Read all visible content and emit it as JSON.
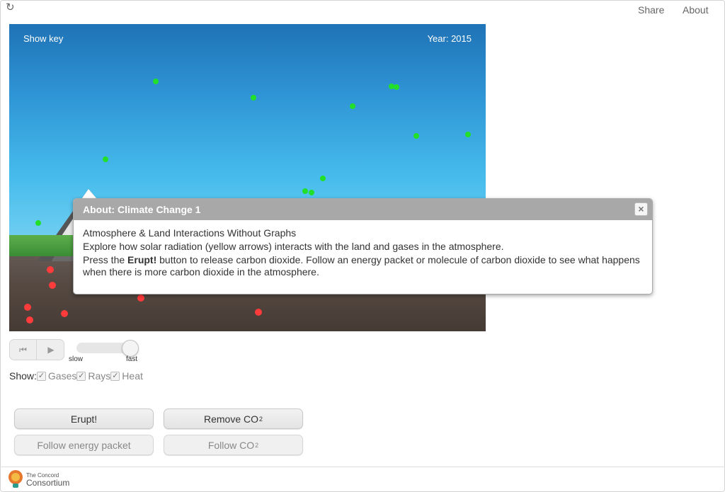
{
  "toolbar": {
    "reload_icon": "reload-icon",
    "share": "Share",
    "about": "About"
  },
  "sim": {
    "show_key": "Show key",
    "year": "Year: 2015",
    "colors": {
      "gas": "#22e02a",
      "heat": "#ff3b3b"
    }
  },
  "controls": {
    "reset_icon": "skip-back-icon",
    "play_icon": "play-icon",
    "slow": "slow",
    "fast": "fast",
    "speed_level": 0.95,
    "show_label": "Show:",
    "show_options": [
      {
        "label": "Gases",
        "checked": true
      },
      {
        "label": "Rays",
        "checked": true
      },
      {
        "label": "Heat",
        "checked": true
      }
    ]
  },
  "buttons": {
    "erupt": "Erupt!",
    "remove_co2": "Remove CO",
    "remove_co2_sub": "2",
    "follow_energy": "Follow energy packet",
    "follow_co2": "Follow CO",
    "follow_co2_sub": "2"
  },
  "footer": {
    "logo_line1": "The Concord",
    "logo_line2": "Consortium"
  },
  "dialog": {
    "title": "About: Climate Change 1",
    "close": "×",
    "line1": "Atmosphere & Land Interactions Without Graphs",
    "line2": "Explore how solar radiation (yellow arrows) interacts with the land and gases in the atmosphere.",
    "line3_pre": "Press the ",
    "line3_bold": "Erupt!",
    "line3_post": " button to release carbon dioxide. Follow an energy packet or molecule of carbon dioxide to see what happens when there is more carbon dioxide in the atmosphere."
  }
}
